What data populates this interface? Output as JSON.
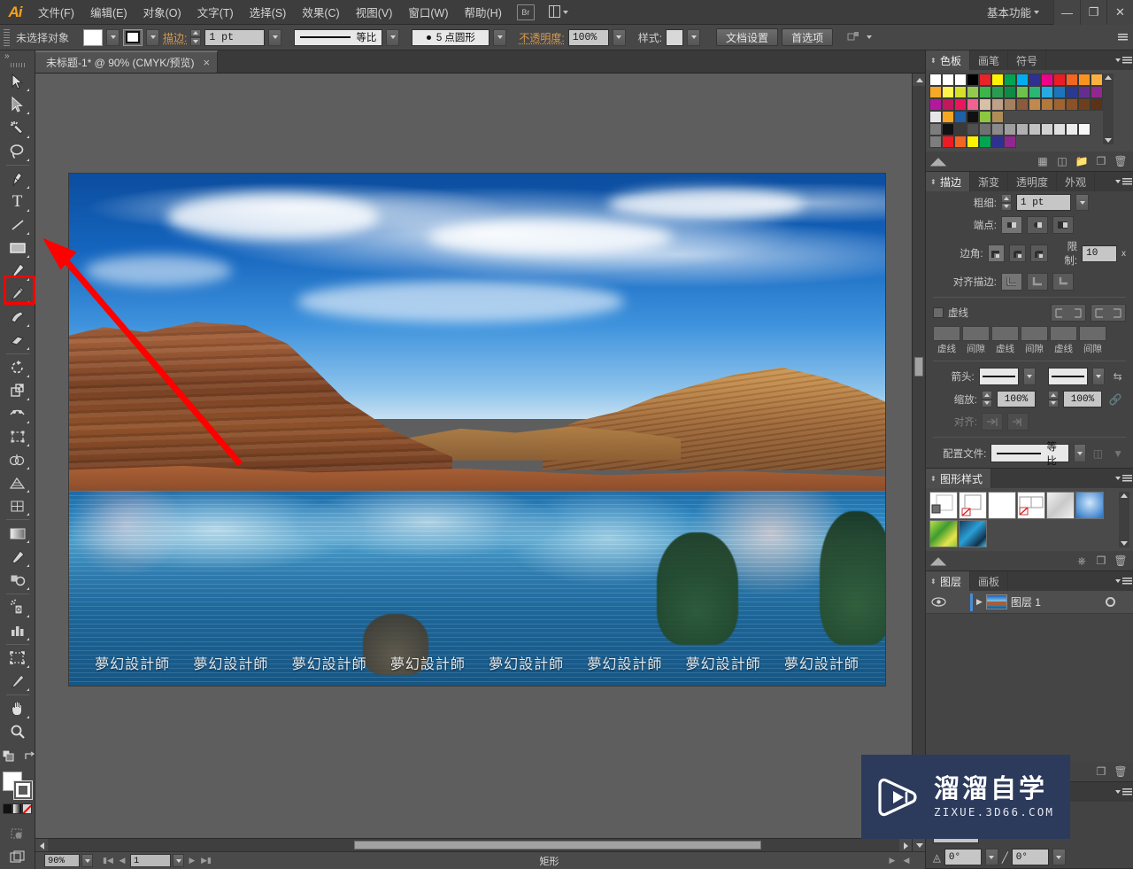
{
  "app": {
    "logo": "Ai",
    "workspace": "基本功能",
    "menus": [
      "文件(F)",
      "编辑(E)",
      "对象(O)",
      "文字(T)",
      "选择(S)",
      "效果(C)",
      "视图(V)",
      "窗口(W)",
      "帮助(H)"
    ],
    "bridge_icon_label": "Br",
    "window_buttons": {
      "minimize": "—",
      "restore": "❐",
      "close": "✕"
    }
  },
  "control_bar": {
    "selection_status": "未选择对象",
    "stroke_label": "描边:",
    "stroke_weight": "1 pt",
    "profile_label": "等比",
    "brush_label": "5 点圆形",
    "opacity_label": "不透明度:",
    "opacity_value": "100%",
    "style_label": "样式:",
    "doc_setup_button": "文档设置",
    "preferences_button": "首选项"
  },
  "document": {
    "tab_title": "未标题-1* @ 90% (CMYK/预览)",
    "close_label": "×",
    "canvas_watermark": "夢幻設計師",
    "watermark_repeat": 8
  },
  "toolbar": {
    "tools": [
      {
        "name": "selection-tool",
        "glyph": "arrow-solid"
      },
      {
        "name": "direct-selection-tool",
        "glyph": "arrow-outline"
      },
      {
        "name": "magic-wand-tool",
        "glyph": "wand"
      },
      {
        "name": "lasso-tool",
        "glyph": "lasso"
      },
      {
        "name": "pen-tool",
        "glyph": "pen"
      },
      {
        "name": "type-tool",
        "glyph": "T"
      },
      {
        "name": "line-segment-tool",
        "glyph": "line"
      },
      {
        "name": "rectangle-tool",
        "glyph": "rectangle"
      },
      {
        "name": "paintbrush-tool",
        "glyph": "brush"
      },
      {
        "name": "pencil-tool",
        "glyph": "pencil"
      },
      {
        "name": "blob-brush-tool",
        "glyph": "blob"
      },
      {
        "name": "eraser-tool",
        "glyph": "eraser"
      },
      {
        "name": "rotate-tool",
        "glyph": "rotate"
      },
      {
        "name": "scale-tool",
        "glyph": "scale"
      },
      {
        "name": "width-tool",
        "glyph": "width"
      },
      {
        "name": "free-transform-tool",
        "glyph": "transform"
      },
      {
        "name": "shape-builder-tool",
        "glyph": "shapebuilder"
      },
      {
        "name": "perspective-grid-tool",
        "glyph": "perspective"
      },
      {
        "name": "mesh-tool",
        "glyph": "mesh"
      },
      {
        "name": "gradient-tool",
        "glyph": "gradient"
      },
      {
        "name": "eyedropper-tool",
        "glyph": "eyedropper"
      },
      {
        "name": "blend-tool",
        "glyph": "blend"
      },
      {
        "name": "symbol-sprayer-tool",
        "glyph": "sprayer"
      },
      {
        "name": "column-graph-tool",
        "glyph": "graph"
      },
      {
        "name": "artboard-tool",
        "glyph": "artboard"
      },
      {
        "name": "slice-tool",
        "glyph": "slice"
      },
      {
        "name": "hand-tool",
        "glyph": "hand"
      },
      {
        "name": "zoom-tool",
        "glyph": "zoom"
      }
    ],
    "highlighted_tool": "rectangle-tool",
    "annotation": {
      "type": "red-arrow",
      "points_to": "rectangle-tool"
    }
  },
  "panels": {
    "swatches": {
      "tabs": [
        "色板",
        "画笔",
        "符号"
      ],
      "active_tab": "色板",
      "rows": [
        [
          "#ffffff",
          "#ffffff",
          "#ffffff",
          "#000000",
          "#e8232a",
          "#fff200",
          "#00a551",
          "#00aeef",
          "#2e3192",
          "#ec008c",
          "#ed1c24",
          "#f26522",
          "#f7941e",
          "#fbb040"
        ],
        [
          "#f7a827",
          "#fff34d",
          "#d4e02a",
          "#93c94c",
          "#3cb54a",
          "#2a9c4f",
          "#0f8a45",
          "#6cc24a",
          "#2bb673",
          "#27aae1",
          "#1c75bc",
          "#2b3990",
          "#662d91",
          "#92278f"
        ],
        [
          "#b5179e",
          "#c2185b",
          "#e8175d",
          "#f06292",
          "#d7c0a8",
          "#bfa088",
          "#a5805f",
          "#8a5c3b",
          "#c08a4e",
          "#b3793c",
          "#9e6532",
          "#8a5226",
          "#6e3f1c",
          "#5a3316"
        ],
        [
          "#e6e6e6",
          "#f6a623",
          "#1e5fa8",
          "#111111",
          "#8dc63f",
          "#b08d57"
        ],
        [
          "#7d7d7d",
          "#111111",
          "#3a3a3a",
          "#4f4f4f",
          "#707070",
          "#8a8a8a",
          "#9e9e9e",
          "#b0b0b0",
          "#c2c2c2",
          "#d2d2d2",
          "#e0e0e0",
          "#ececec",
          "#f7f7f7"
        ],
        [
          "#7d7d7d",
          "#ed1c24",
          "#f26522",
          "#fff200",
          "#00a551",
          "#2e3192",
          "#92278f"
        ]
      ]
    },
    "stroke": {
      "tabs": [
        "描边",
        "渐变",
        "透明度",
        "外观"
      ],
      "active_tab": "描边",
      "weight_label": "粗细:",
      "weight_value": "1 pt",
      "cap_label": "端点:",
      "corner_label": "边角:",
      "limit_label": "限制:",
      "limit_value": "10",
      "limit_unit": "x",
      "align_label": "对齐描边:",
      "dashed_label": "虚线",
      "dash_fields": [
        "虚线",
        "间隙",
        "虚线",
        "间隙",
        "虚线",
        "间隙"
      ],
      "arrow_label": "箭头:",
      "scale_label": "缩放:",
      "scale_value_1": "100%",
      "scale_value_2": "100%",
      "align_arrows_label": "对齐:",
      "profile_label": "配置文件:",
      "profile_value": "等比"
    },
    "graphic_styles": {
      "title": "图形样式",
      "swatch_count": 8
    },
    "layers": {
      "tabs": [
        "图层",
        "画板"
      ],
      "active_tab": "图层",
      "rows": [
        {
          "name": "图层 1",
          "visible": true,
          "selected": true
        }
      ]
    },
    "transform": {
      "angle_1": "0°",
      "angle_2": "0°"
    }
  },
  "status_bar": {
    "zoom": "90%",
    "page": "1",
    "tool_status": "矩形"
  },
  "branding": {
    "watermark_cn": "溜溜自学",
    "watermark_url": "ZIXUE.3D66.COM"
  },
  "colors": {
    "chrome": "#474747",
    "panel": "#434343",
    "accent_orange": "#d99a4e",
    "annotation_red": "#ff0000",
    "selection_blue": "#4b8cd6",
    "watermark_navy": "#2c3a5c"
  }
}
